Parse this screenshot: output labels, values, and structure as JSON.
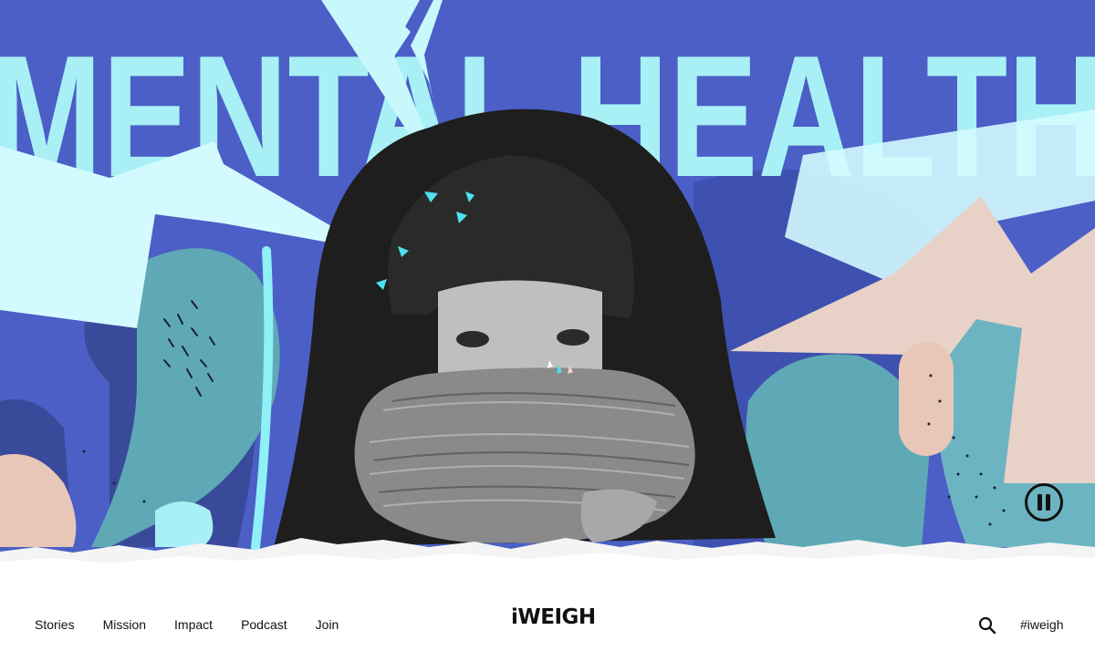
{
  "hero": {
    "headline": "MENTAL HEALTH",
    "colors": {
      "sky_blue": "#a8f0f5",
      "royal_blue": "#4b5fc6",
      "deep_blue": "#3a4a9a",
      "teal": "#5fa9b6",
      "peach": "#e8d2c8",
      "ink": "#1b1f3a"
    },
    "pause_icon": "pause-icon"
  },
  "nav": {
    "items": [
      "Stories",
      "Mission",
      "Impact",
      "Podcast",
      "Join"
    ],
    "logo": "iWEIGH",
    "search_icon": "search-icon",
    "hashtag": "#iweigh"
  }
}
